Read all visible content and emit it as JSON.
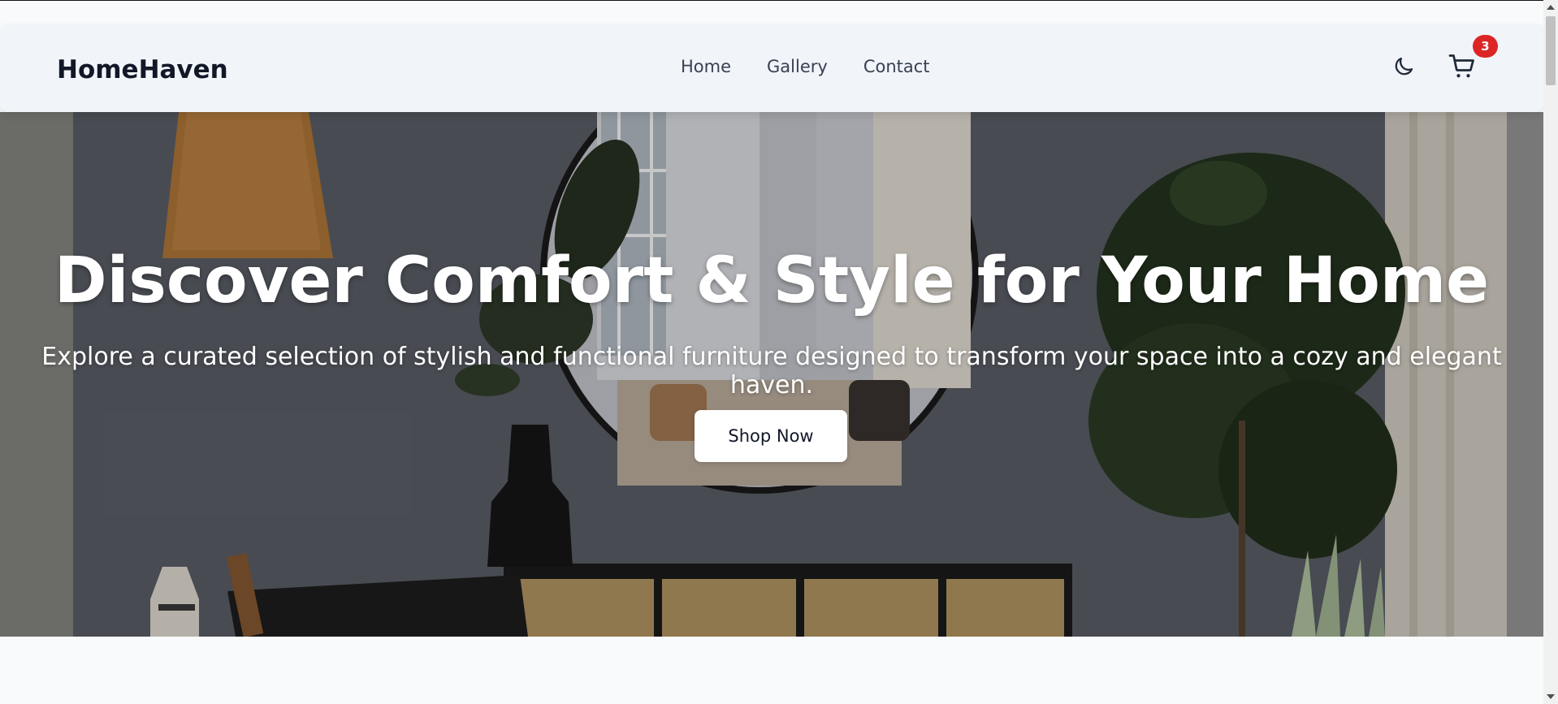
{
  "brand": {
    "name": "HomeHaven"
  },
  "nav": {
    "links": [
      {
        "label": "Home"
      },
      {
        "label": "Gallery"
      },
      {
        "label": "Contact"
      }
    ]
  },
  "actions": {
    "theme_icon": "moon-icon",
    "cart_icon": "cart-icon",
    "cart_count": "3"
  },
  "hero": {
    "title": "Discover Comfort & Style for Your Home",
    "subtitle": "Explore a curated selection of stylish and functional furniture designed to transform your space into a cozy and elegant haven.",
    "cta_label": "Shop Now"
  },
  "colors": {
    "badge": "#dc2626",
    "navbar_bg": "#f1f4f9",
    "text_dark": "#111827"
  }
}
